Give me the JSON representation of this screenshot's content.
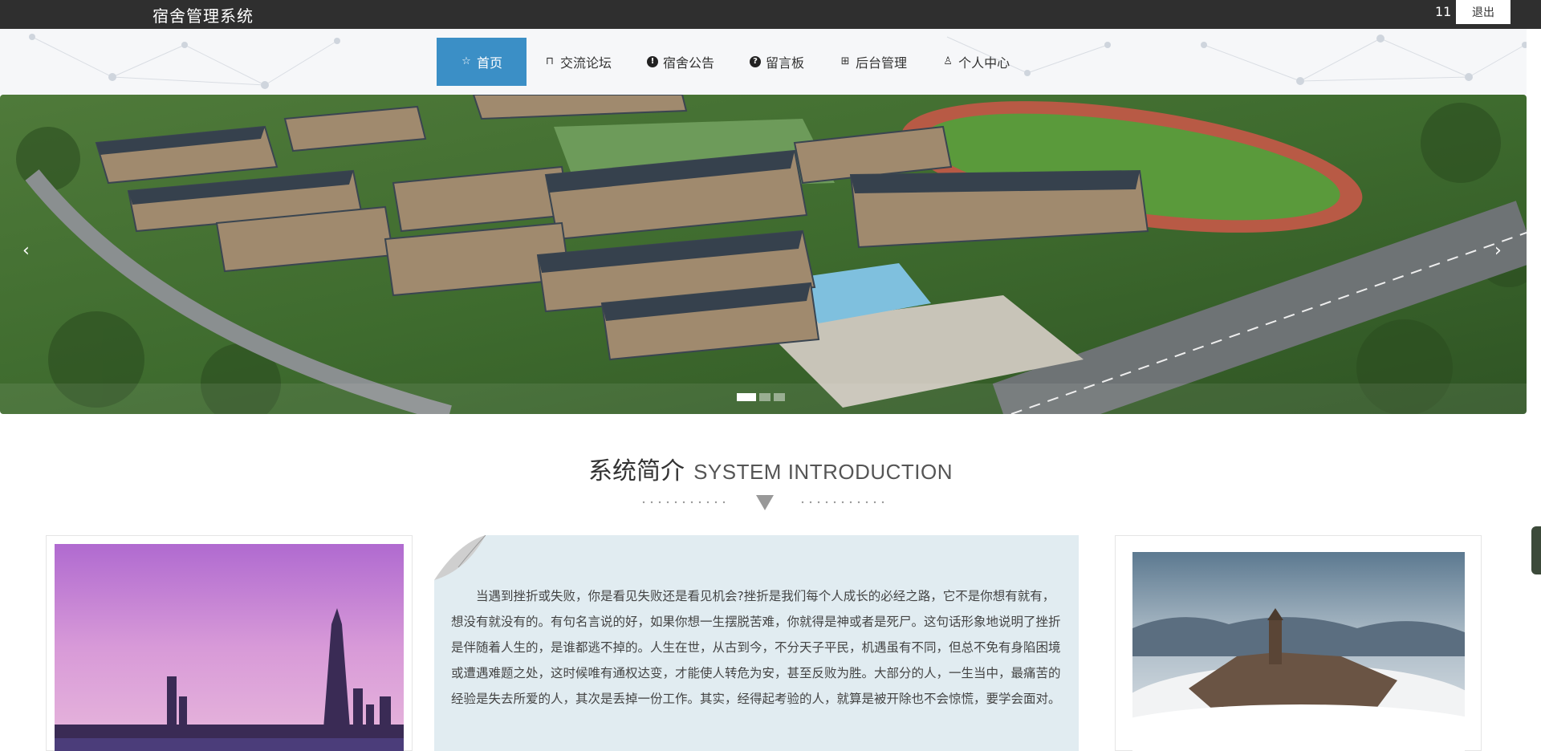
{
  "header": {
    "title": "宿舍管理系统",
    "user_count": "11",
    "logout_label": "退出"
  },
  "nav": {
    "items": [
      {
        "label": "首页",
        "icon": "star-icon",
        "active": true
      },
      {
        "label": "交流论坛",
        "icon": "bag-icon"
      },
      {
        "label": "宿舍公告",
        "icon": "exclamation-icon"
      },
      {
        "label": "留言板",
        "icon": "question-icon"
      },
      {
        "label": "后台管理",
        "icon": "gift-icon"
      },
      {
        "label": "个人中心",
        "icon": "user-icon"
      }
    ]
  },
  "carousel": {
    "prev_label": "‹",
    "next_label": "›",
    "slide_count": 3,
    "active_index": 0
  },
  "intro": {
    "title_cn": "系统简介",
    "title_en": "SYSTEM INTRODUCTION",
    "body": "当遇到挫折或失败，你是看见失败还是看见机会?挫折是我们每个人成长的必经之路，它不是你想有就有，想没有就没有的。有句名言说的好，如果你想一生摆脱苦难，你就得是神或者是死尸。这句话形象地说明了挫折是伴随着人生的，是谁都逃不掉的。人生在世，从古到今，不分天子平民，机遇虽有不同，但总不免有身陷困境或遭遇难题之处，这时候唯有通权达变，才能使人转危为安，甚至反败为胜。大部分的人，一生当中，最痛苦的经验是失去所爱的人，其次是丢掉一份工作。其实，经得起考验的人，就算是被开除也不会惊慌，要学会面对。"
  },
  "colors": {
    "topbar": "#2f2f2f",
    "nav_active": "#3b8fc6",
    "intro_card": "#e1ecf1"
  }
}
